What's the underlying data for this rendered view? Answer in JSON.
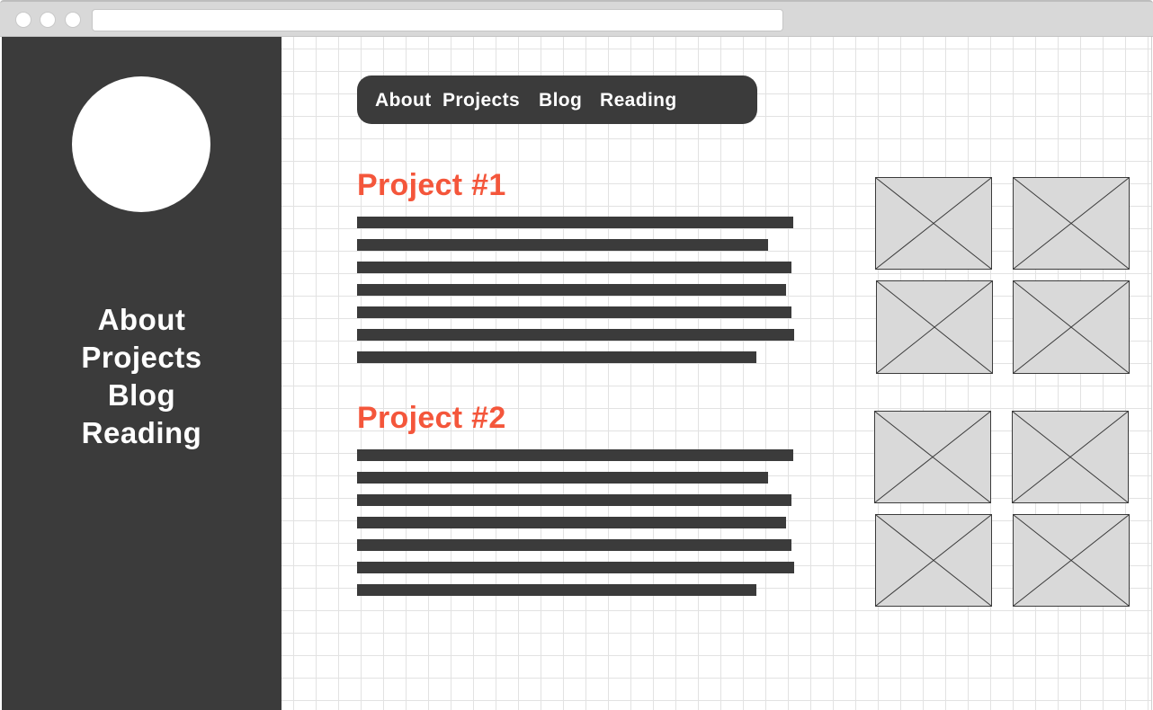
{
  "window": {
    "controls": [
      "close",
      "minimize",
      "maximize"
    ],
    "url": ""
  },
  "sidebar": {
    "avatar": "profile-photo",
    "nav": [
      {
        "label": "About"
      },
      {
        "label": "Projects"
      },
      {
        "label": "Blog"
      },
      {
        "label": "Reading"
      }
    ]
  },
  "topnav": {
    "items": [
      {
        "label": "About"
      },
      {
        "label": "Projects"
      },
      {
        "label": "Blog"
      },
      {
        "label": "Reading"
      }
    ]
  },
  "projects": [
    {
      "title": "Project #1",
      "text_lines": 7,
      "images": 4
    },
    {
      "title": "Project #2",
      "text_lines": 7,
      "images": 4
    }
  ],
  "colors": {
    "dark": "#3b3b3b",
    "accent": "#f4563b",
    "grid": "#e2e2e2",
    "placeholder": "#d9d9d9"
  }
}
